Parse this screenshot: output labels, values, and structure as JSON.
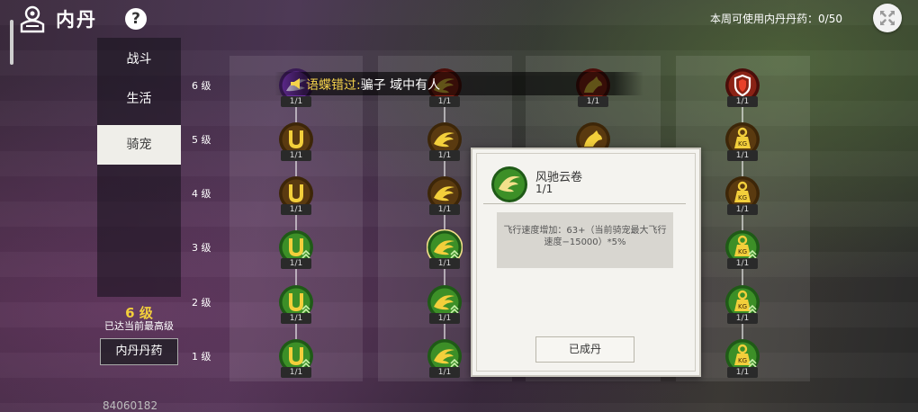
{
  "header": {
    "title": "内丹",
    "help_label": "?",
    "weekly_text": "本周可使用内丹丹药：0/50"
  },
  "tabs": [
    {
      "label": "战斗"
    },
    {
      "label": "生活"
    },
    {
      "label": "骑宠",
      "active": true
    }
  ],
  "level_status": {
    "current": "6 级",
    "note": "已达当前最高级"
  },
  "potion_button": "内丹丹药",
  "player_id": "84060182",
  "levels": [
    "6 级",
    "5 级",
    "4 级",
    "3 级",
    "2 级",
    "1 级"
  ],
  "columns": [
    {
      "nodes": [
        {
          "level": 6,
          "icon": "purple-wind-icon",
          "count": "1/1"
        },
        {
          "level": 5,
          "icon": "horseshoe-icon",
          "count": "1/1"
        },
        {
          "level": 4,
          "icon": "horseshoe-icon",
          "count": "1/1"
        },
        {
          "level": 3,
          "icon": "horseshoe-arrows-icon",
          "count": "1/1"
        },
        {
          "level": 2,
          "icon": "horseshoe-arrows-icon",
          "count": "1/1"
        },
        {
          "level": 1,
          "icon": "horseshoe-arrows-icon",
          "count": "1/1"
        }
      ]
    },
    {
      "nodes": [
        {
          "level": 6,
          "icon": "red-wing-icon",
          "count": "1/1"
        },
        {
          "level": 5,
          "icon": "wing-icon",
          "count": "1/1"
        },
        {
          "level": 4,
          "icon": "wing-icon",
          "count": "1/1"
        },
        {
          "level": 3,
          "icon": "wing-arrows-icon",
          "count": "1/1",
          "selected": true
        },
        {
          "level": 2,
          "icon": "wing-arrows-icon",
          "count": "1/1"
        },
        {
          "level": 1,
          "icon": "wing-arrows-icon",
          "count": "1/1"
        }
      ]
    },
    {
      "nodes": [
        {
          "level": 6,
          "icon": "red-horse-icon",
          "count": "1/1"
        },
        {
          "level": 5,
          "icon": "horse-icon",
          "count": "1/1"
        }
      ]
    },
    {
      "nodes": [
        {
          "level": 6,
          "icon": "red-shield-icon",
          "count": "1/1"
        },
        {
          "level": 5,
          "icon": "weight-icon",
          "count": "1/1"
        },
        {
          "level": 4,
          "icon": "weight-icon",
          "count": "1/1"
        },
        {
          "level": 3,
          "icon": "weight-arrows-icon",
          "count": "1/1"
        },
        {
          "level": 2,
          "icon": "weight-arrows-icon",
          "count": "1/1"
        },
        {
          "level": 1,
          "icon": "weight-arrows-icon",
          "count": "1/1"
        }
      ]
    }
  ],
  "weight_label": "KG",
  "banner": {
    "name": "语蝶错过:",
    "message": "骗子  域中有人"
  },
  "popup": {
    "title": "风驰云卷",
    "count": "1/1",
    "description": "飞行速度增加：63+（当前骑宠最大飞行速度−15000）*5%",
    "button": "已成丹"
  },
  "colors": {
    "gold": "#f3cf3b",
    "green_node": "#2e7d1e",
    "brown_node": "#5a3a10",
    "red_node": "#7a1a12",
    "tab_active_bg": "#efeee9",
    "popup_bg": "#f4f3ef"
  }
}
